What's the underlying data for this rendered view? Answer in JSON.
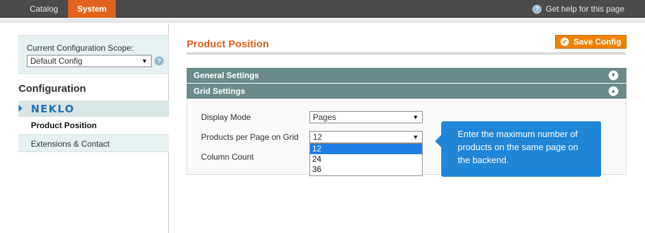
{
  "topbar": {
    "tabs": [
      {
        "label": "Catalog",
        "active": false
      },
      {
        "label": "System",
        "active": true
      }
    ],
    "help_label": "Get help for this page"
  },
  "sidebar": {
    "scope_label": "Current Configuration Scope:",
    "scope_value": "Default Config",
    "config_title": "Configuration",
    "group_logo": "NEKLO",
    "items": [
      {
        "label": "Product Position",
        "active": true
      },
      {
        "label": "Extensions & Contact",
        "active": false
      }
    ]
  },
  "main": {
    "page_title": "Product Position",
    "save_label": "Save Config",
    "sections": [
      {
        "title": "General Settings",
        "expanded": false
      },
      {
        "title": "Grid Settings",
        "expanded": true
      }
    ],
    "fields": {
      "display_mode": {
        "label": "Display Mode",
        "value": "Pages"
      },
      "per_page": {
        "label": "Products per Page on Grid",
        "value": "12",
        "options": [
          "12",
          "24",
          "36"
        ],
        "highlighted": "12"
      },
      "column_count": {
        "label": "Column Count"
      }
    },
    "tooltip": "Enter the maximum number of products on the same page on the backend."
  },
  "colors": {
    "accent": "#e2621b",
    "save_button": "#f18200",
    "section_header": "#6b8b8b",
    "tooltip": "#1f86d8",
    "highlight": "#1e7ee5"
  }
}
